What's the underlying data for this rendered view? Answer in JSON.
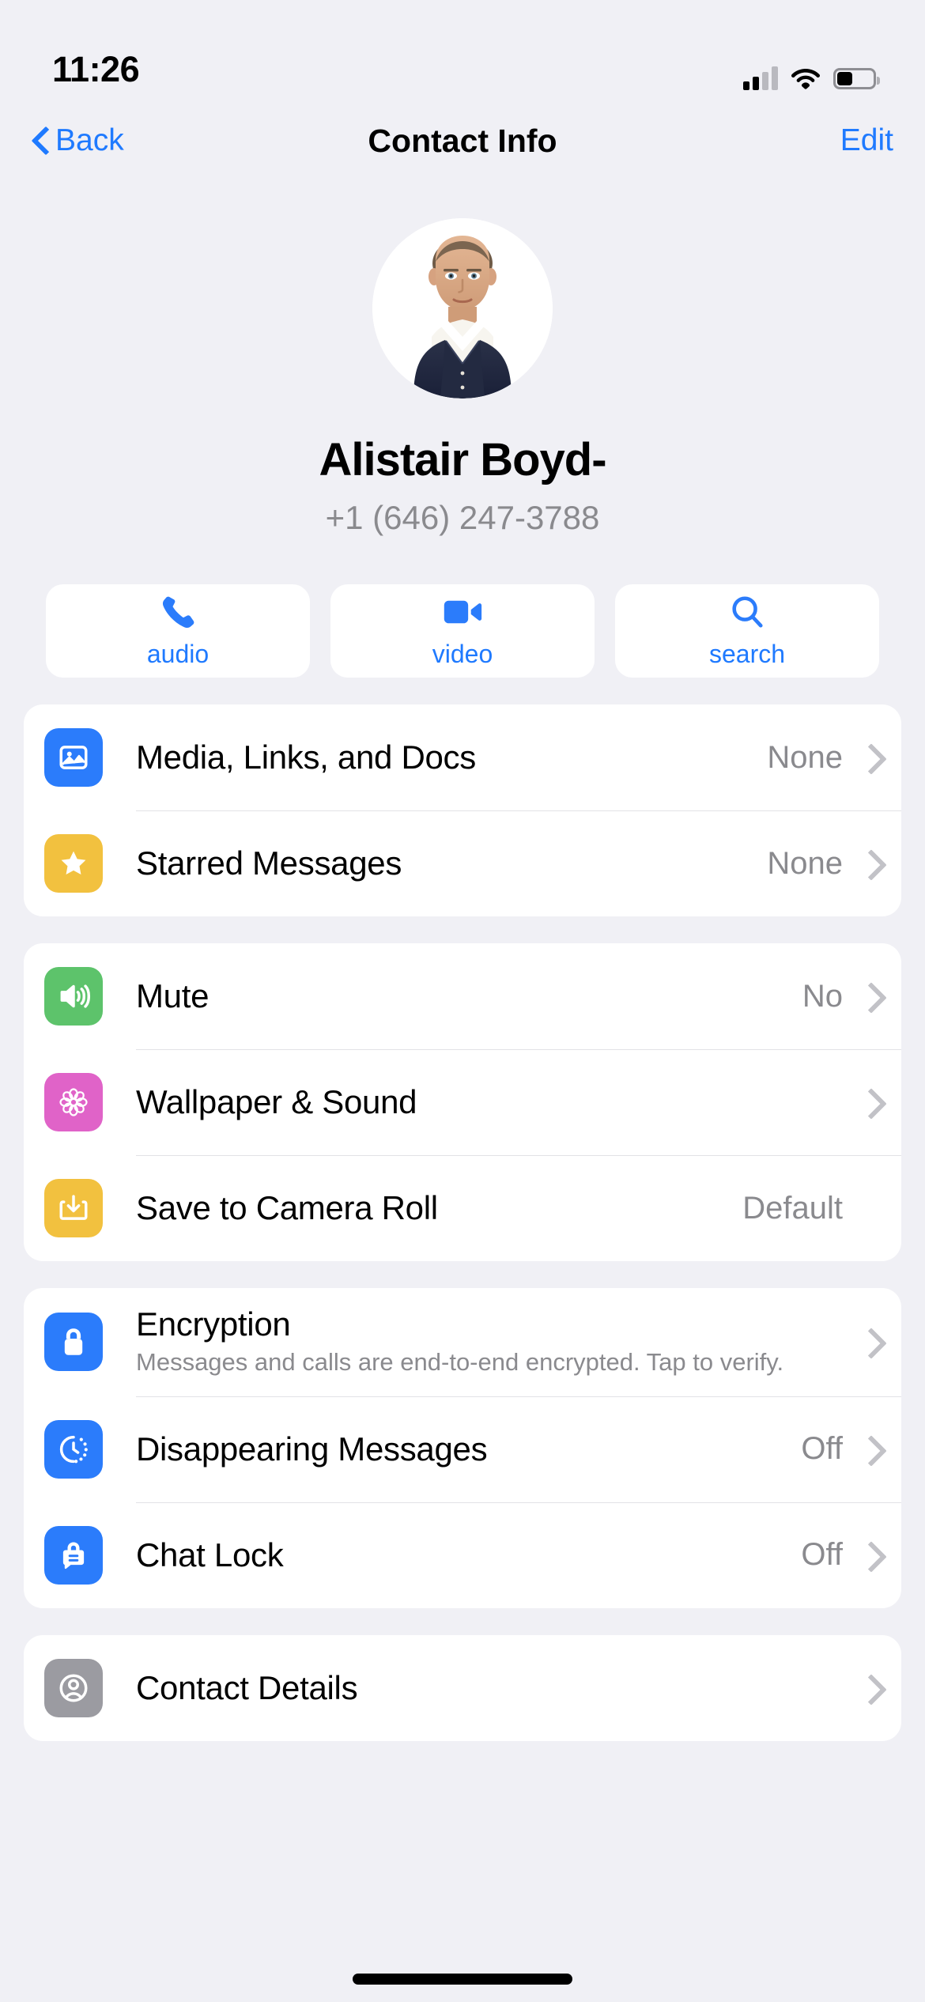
{
  "status_bar": {
    "time": "11:26",
    "cellular_icon": "cellular-signal-icon",
    "cellular_bars_filled": 2,
    "cellular_bars_total": 4,
    "wifi_icon": "wifi-icon",
    "battery_icon": "battery-icon",
    "battery_level_percent": 40
  },
  "nav": {
    "back_label": "Back",
    "title": "Contact Info",
    "edit_label": "Edit",
    "back_icon": "chevron-left-icon",
    "accent_color": "#1f7aff"
  },
  "profile": {
    "avatar_icon": "contact-avatar-photo",
    "name": "Alistair Boyd-",
    "phone": "+1 (646) 247-3788"
  },
  "actions": [
    {
      "id": "audio",
      "label": "audio",
      "icon": "phone-icon"
    },
    {
      "id": "video",
      "label": "video",
      "icon": "video-camera-icon"
    },
    {
      "id": "search",
      "label": "search",
      "icon": "search-icon"
    }
  ],
  "groups": [
    {
      "id": "media-group",
      "rows": [
        {
          "label": "Media, Links, and Docs",
          "value": "None",
          "sub": "",
          "icon": "photo-icon",
          "icon_color": "#2b7cfb",
          "chevron": true
        },
        {
          "label": "Starred Messages",
          "value": "None",
          "sub": "",
          "icon": "star-icon",
          "icon_color": "#f2c13f",
          "chevron": true
        }
      ]
    },
    {
      "id": "chat-settings-group",
      "rows": [
        {
          "label": "Mute",
          "value": "No",
          "sub": "",
          "icon": "speaker-icon",
          "icon_color": "#5dc36b",
          "chevron": true
        },
        {
          "label": "Wallpaper & Sound",
          "value": "",
          "sub": "",
          "icon": "flower-icon",
          "icon_color": "#e063c8",
          "chevron": true
        },
        {
          "label": "Save to Camera Roll",
          "value": "Default",
          "sub": "",
          "icon": "download-icon",
          "icon_color": "#f2c13f",
          "chevron": false
        }
      ]
    },
    {
      "id": "privacy-group",
      "rows": [
        {
          "label": "Encryption",
          "value": "",
          "sub": "Messages and calls are end-to-end encrypted. Tap to verify.",
          "icon": "lock-icon",
          "icon_color": "#2b7cfb",
          "chevron": true
        },
        {
          "label": "Disappearing Messages",
          "value": "Off",
          "sub": "",
          "icon": "timer-icon",
          "icon_color": "#2b7cfb",
          "chevron": true
        },
        {
          "label": "Chat Lock",
          "value": "Off",
          "sub": "",
          "icon": "chat-lock-icon",
          "icon_color": "#2b7cfb",
          "chevron": true
        }
      ]
    },
    {
      "id": "contact-details-group",
      "rows": [
        {
          "label": "Contact Details",
          "value": "",
          "sub": "",
          "icon": "contact-card-icon",
          "icon_color": "#9b9ba1",
          "chevron": true
        }
      ]
    }
  ],
  "home_indicator": "home-indicator"
}
